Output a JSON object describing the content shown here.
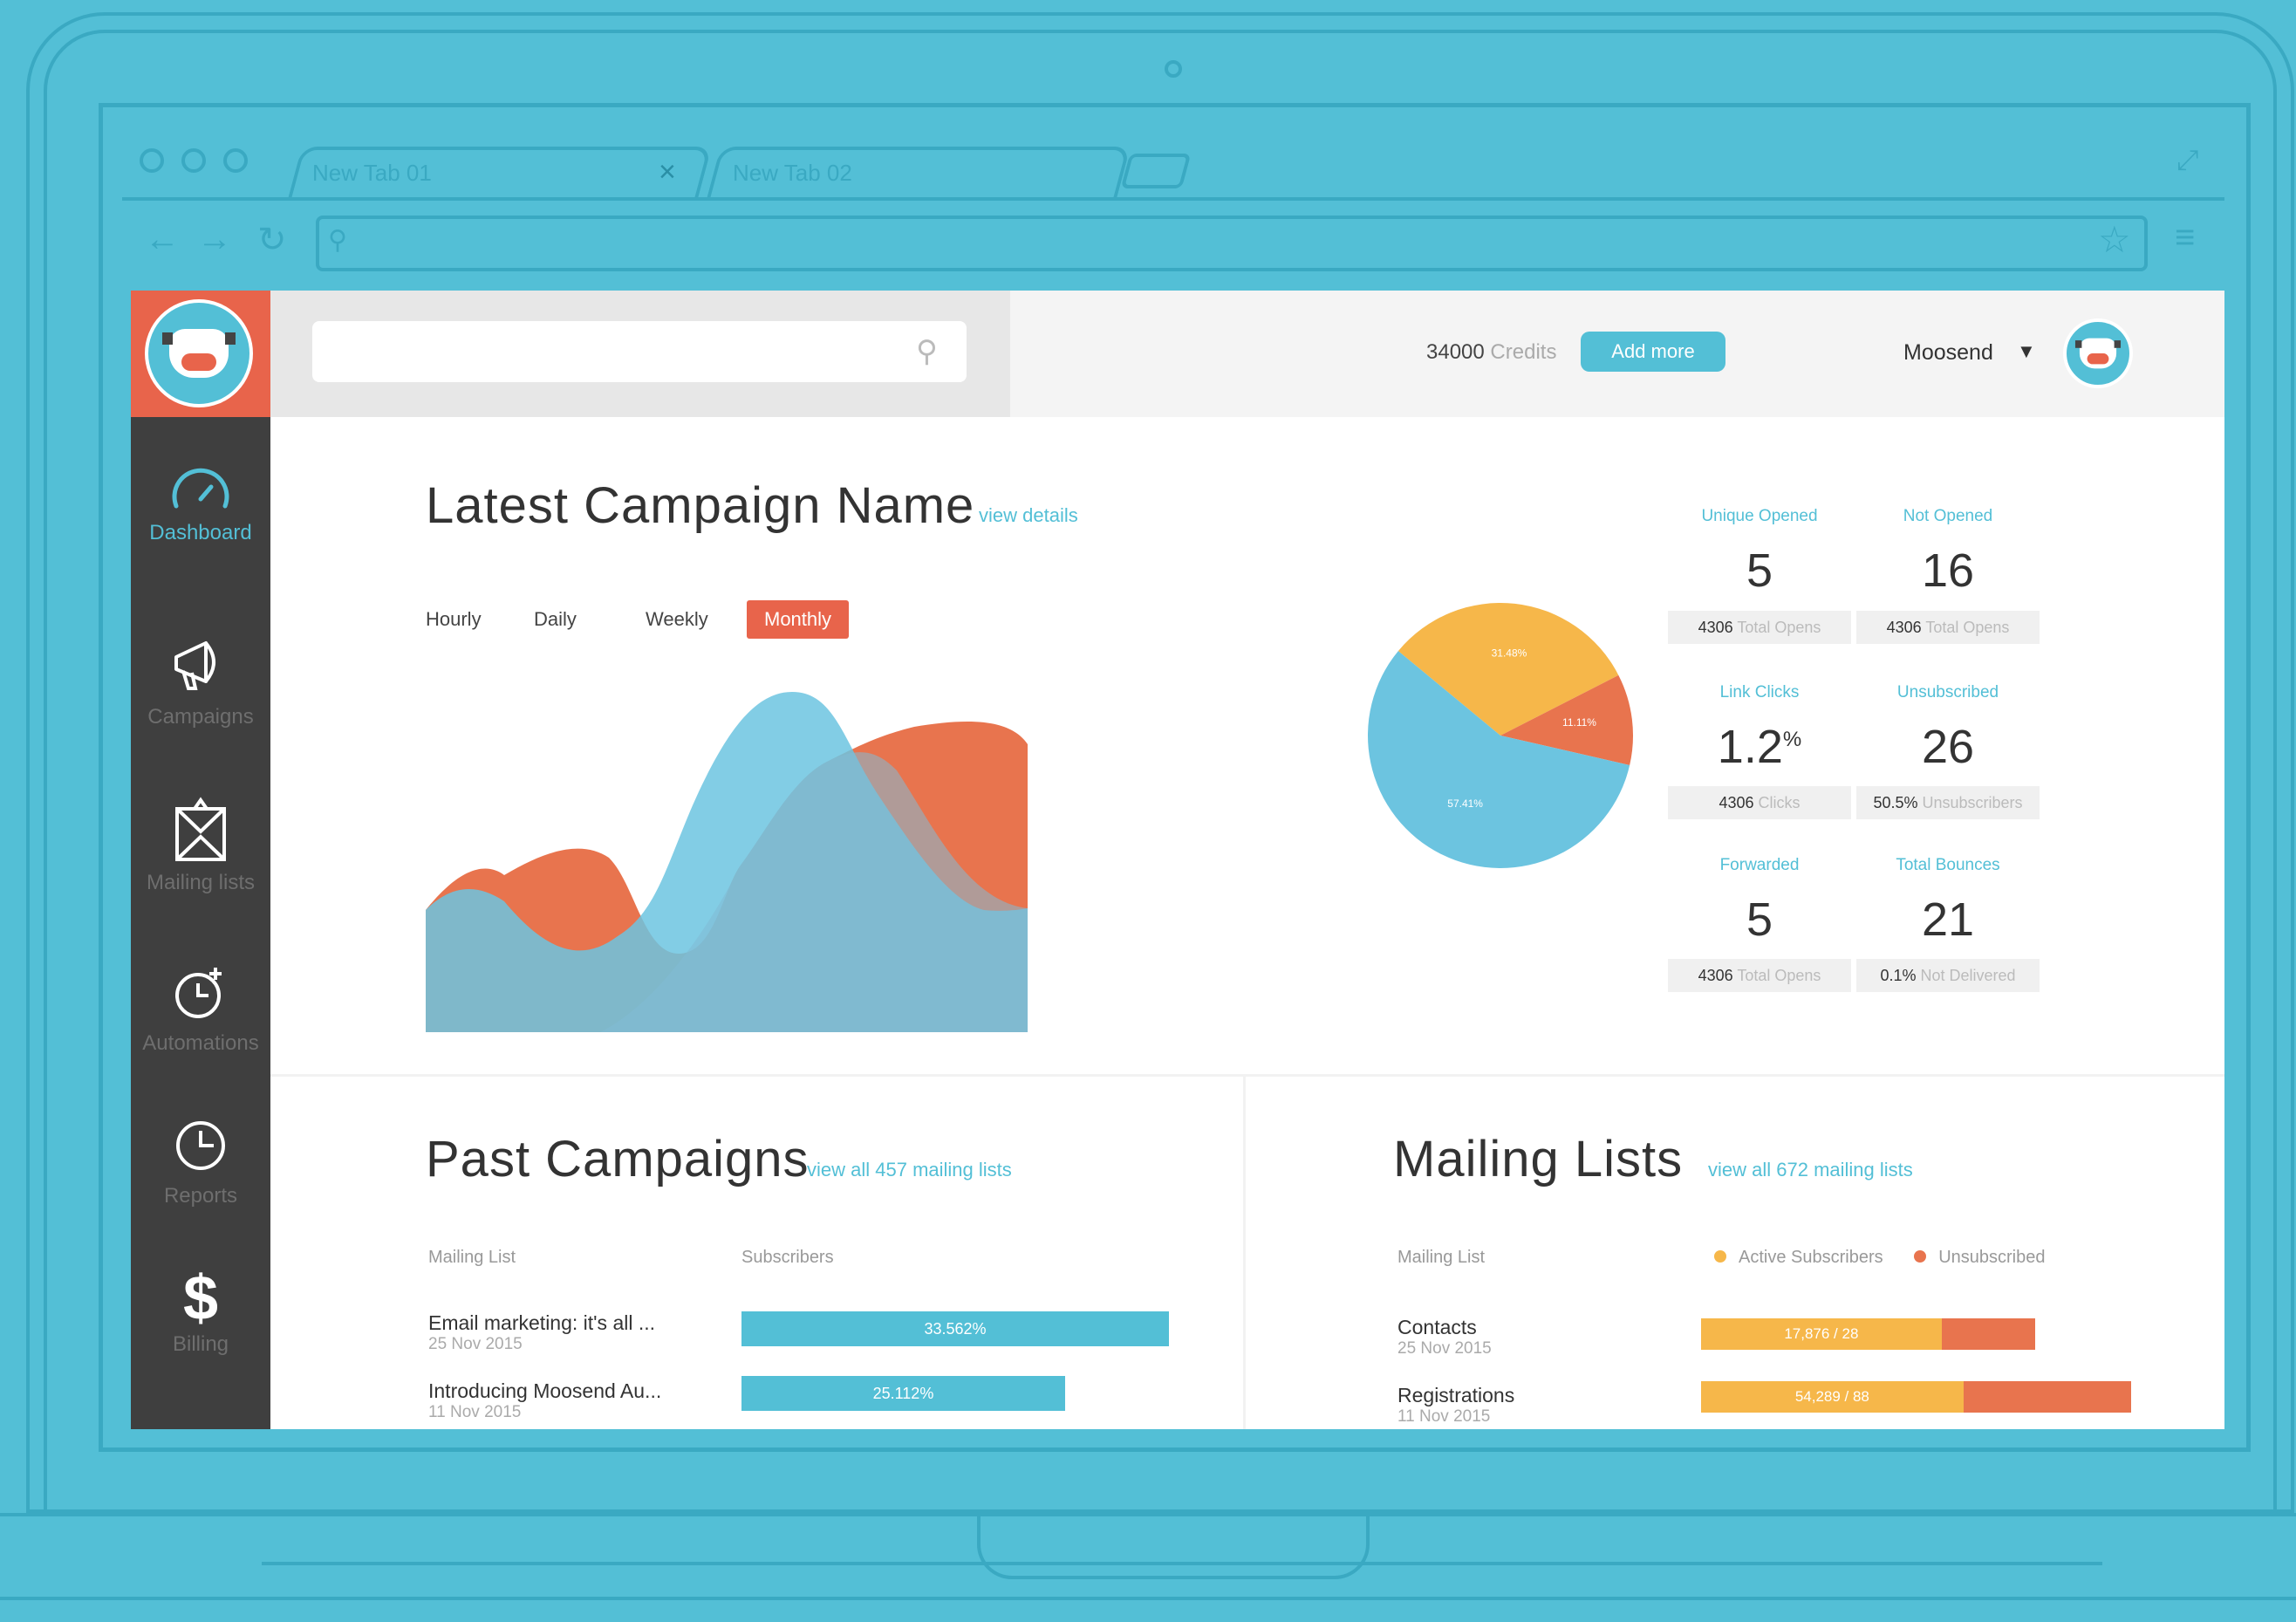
{
  "browser": {
    "tabs": [
      {
        "label": "New Tab 01"
      },
      {
        "label": "New Tab 02"
      }
    ],
    "tab_close_glyph": "×",
    "url": ""
  },
  "sidebar": {
    "items": [
      {
        "label": "Dashboard",
        "icon": "speedometer-icon",
        "glyph": "◠"
      },
      {
        "label": "Campaigns",
        "icon": "megaphone-icon",
        "glyph": "📣"
      },
      {
        "label": "Mailing lists",
        "icon": "envelope-icon",
        "glyph": "✉"
      },
      {
        "label": "Automations",
        "icon": "clock-plus-icon",
        "glyph": "◷"
      },
      {
        "label": "Reports",
        "icon": "pie-icon",
        "glyph": "◔"
      },
      {
        "label": "Billing",
        "icon": "dollar-icon",
        "glyph": "$"
      }
    ]
  },
  "topbar": {
    "search_placeholder": "",
    "credits_value": "34000",
    "credits_label": "Credits",
    "add_more": "Add more",
    "user": "Moosend",
    "caret": "▼"
  },
  "campaign": {
    "title": "Latest Campaign Name",
    "view_details": "view details",
    "periods": [
      "Hourly",
      "Daily",
      "Weekly",
      "Monthly"
    ],
    "active_period": "Monthly"
  },
  "pie": {
    "slices": [
      {
        "label": "31.48%",
        "value": 31.48,
        "color": "#f6b74a"
      },
      {
        "label": "11.11%",
        "value": 11.11,
        "color": "#e8744e"
      },
      {
        "label": "57.41%",
        "value": 57.41,
        "color": "#6cc4e0"
      }
    ]
  },
  "stats": [
    {
      "label": "Unique Opened",
      "value": "5",
      "sup": "",
      "foot_num": "4306",
      "foot_text": "Total Opens"
    },
    {
      "label": "Not Opened",
      "value": "16",
      "sup": "",
      "foot_num": "4306",
      "foot_text": "Total Opens"
    },
    {
      "label": "Link Clicks",
      "value": "1.2",
      "sup": "%",
      "foot_num": "4306",
      "foot_text": "Clicks"
    },
    {
      "label": "Unsubscribed",
      "value": "26",
      "sup": "",
      "foot_num": "50.5%",
      "foot_text": "Unsubscribers"
    },
    {
      "label": "Forwarded",
      "value": "5",
      "sup": "",
      "foot_num": "4306",
      "foot_text": "Total Opens"
    },
    {
      "label": "Total Bounces",
      "value": "21",
      "sup": "",
      "foot_num": "0.1%",
      "foot_text": "Not Delivered"
    }
  ],
  "colors": {
    "accent": "#53bfd6",
    "orange": "#e8744e",
    "yellow": "#f6b74a",
    "sidebar": "#3f3f3f"
  },
  "past": {
    "title": "Past Campaigns",
    "link": "view all 457 mailing lists",
    "col_list": "Mailing List",
    "col_subs": "Subscribers",
    "rows": [
      {
        "title": "Email marketing: it's all ...",
        "date": "25 Nov 2015",
        "pct": "33.562%",
        "fill": 1.0
      },
      {
        "title": "Introducing Moosend Au...",
        "date": "11 Nov 2015",
        "pct": "25.112%",
        "fill": 0.757
      }
    ]
  },
  "lists": {
    "title": "Mailing Lists",
    "link": "view all 672 mailing lists",
    "col_list": "Mailing List",
    "legend_active": "Active Subscribers",
    "legend_unsub": "Unsubscribed",
    "rows": [
      {
        "title": "Contacts",
        "date": "25 Nov 2015",
        "label": "17,876 / 28",
        "active_fill": 0.72,
        "unsub_fill": 0.28
      },
      {
        "title": "Registrations",
        "date": "11 Nov 2015",
        "label": "54,289 / 88",
        "active_fill": 0.61,
        "unsub_fill": 0.39
      }
    ]
  }
}
